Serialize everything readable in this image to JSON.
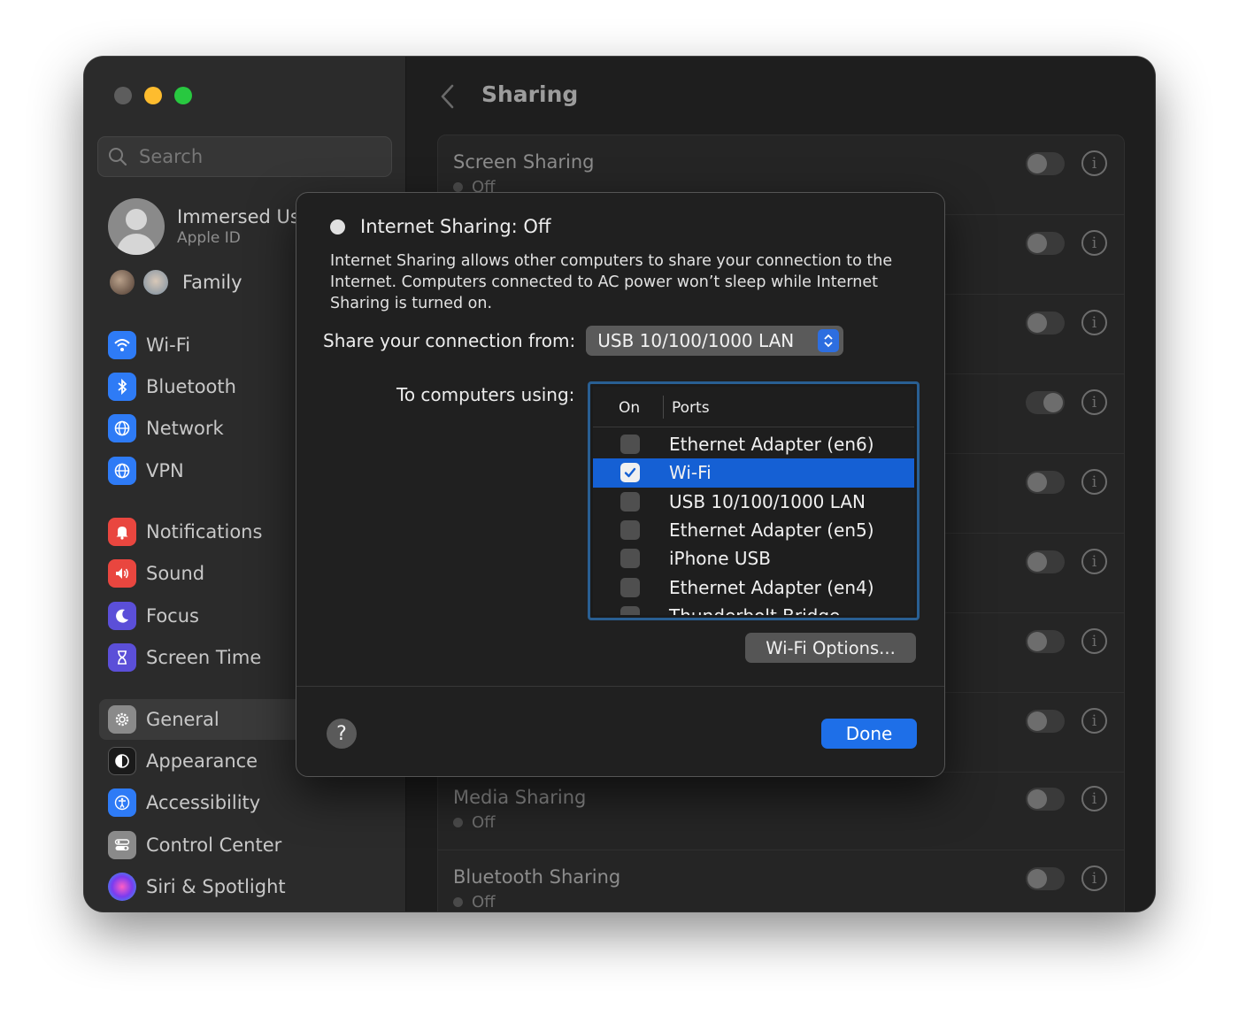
{
  "sidebar": {
    "search_placeholder": "Search",
    "profile": {
      "name": "Immersed Us",
      "sub": "Apple ID"
    },
    "family_label": "Family",
    "items": [
      {
        "label": "Wi-Fi",
        "icon": "wifi-icon",
        "color": "#2e7bf6"
      },
      {
        "label": "Bluetooth",
        "icon": "bluetooth-icon",
        "color": "#2e7bf6"
      },
      {
        "label": "Network",
        "icon": "globe-icon",
        "color": "#2e7bf6"
      },
      {
        "label": "VPN",
        "icon": "vpn-globe-icon",
        "color": "#2e7bf6"
      },
      {
        "label": "Notifications",
        "icon": "bell-icon",
        "color": "#e9463f"
      },
      {
        "label": "Sound",
        "icon": "speaker-icon",
        "color": "#e9463f"
      },
      {
        "label": "Focus",
        "icon": "moon-icon",
        "color": "#5b4fd8"
      },
      {
        "label": "Screen Time",
        "icon": "hourglass-icon",
        "color": "#5b4fd8"
      },
      {
        "label": "General",
        "icon": "gear-icon",
        "color": "#8a8a8a"
      },
      {
        "label": "Appearance",
        "icon": "appearance-icon",
        "color": "#1a1a1a"
      },
      {
        "label": "Accessibility",
        "icon": "accessibility-icon",
        "color": "#2e7bf6"
      },
      {
        "label": "Control Center",
        "icon": "control-center-icon",
        "color": "#8a8a8a"
      },
      {
        "label": "Siri & Spotlight",
        "icon": "siri-icon",
        "color": "#b040e0"
      }
    ]
  },
  "main": {
    "title": "Sharing",
    "rows": [
      {
        "title": "Screen Sharing",
        "status": "Off"
      },
      {
        "title": "Media Sharing",
        "status": "Off"
      },
      {
        "title": "Bluetooth Sharing",
        "status": "Off"
      }
    ]
  },
  "dialog": {
    "status": "Internet Sharing: Off",
    "description": "Internet Sharing allows other computers to share your connection to the Internet. Computers connected to AC power won’t sleep while Internet Sharing is turned on.",
    "share_from_label": "Share your connection from:",
    "share_from_value": "USB 10/100/1000 LAN",
    "to_computers_label": "To computers using:",
    "ports_header": {
      "on": "On",
      "ports": "Ports"
    },
    "ports": [
      {
        "name": "Ethernet Adapter (en6)",
        "checked": false
      },
      {
        "name": "Wi-Fi",
        "checked": true
      },
      {
        "name": "USB 10/100/1000 LAN",
        "checked": false
      },
      {
        "name": "Ethernet Adapter (en5)",
        "checked": false
      },
      {
        "name": "iPhone USB",
        "checked": false
      },
      {
        "name": "Ethernet Adapter (en4)",
        "checked": false
      },
      {
        "name": "Thunderbolt Bridge",
        "checked": false
      }
    ],
    "wifi_options_label": "Wi-Fi Options...",
    "help_label": "?",
    "done_label": "Done"
  },
  "colors": {
    "accent": "#1e6fe8",
    "selection": "#1560d4"
  }
}
